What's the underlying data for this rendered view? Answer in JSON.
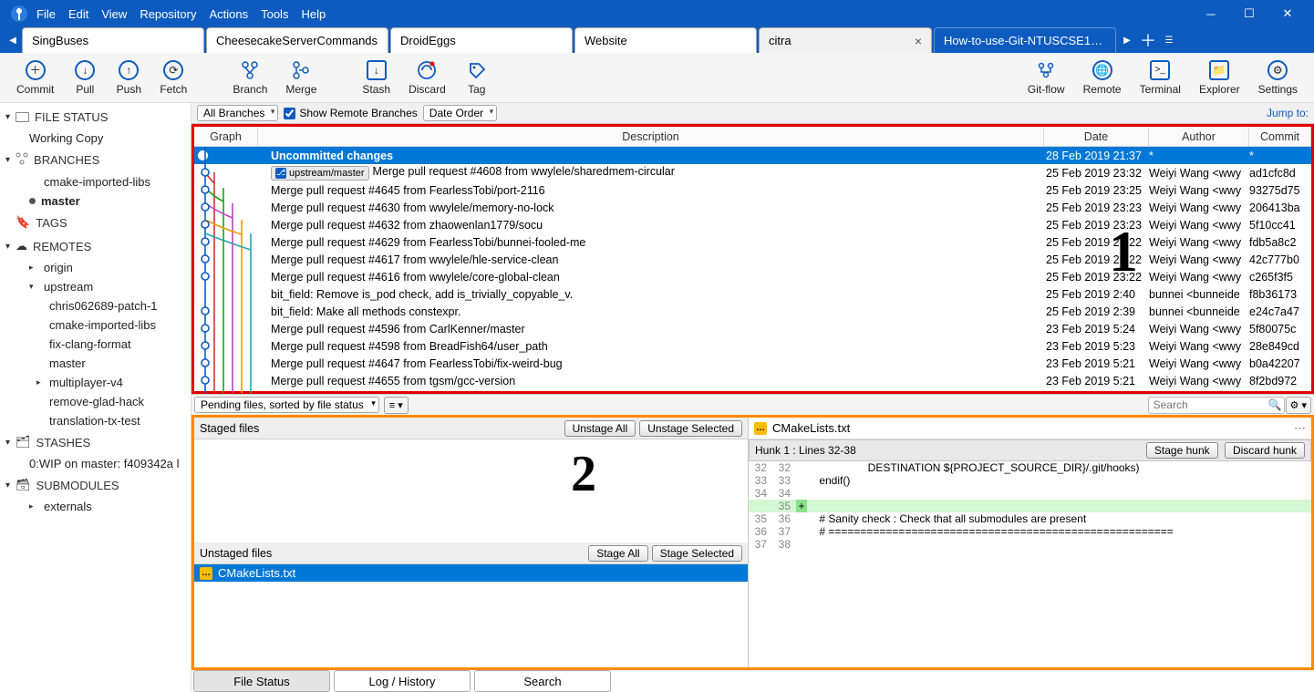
{
  "menu": {
    "file": "File",
    "edit": "Edit",
    "view": "View",
    "repository": "Repository",
    "actions": "Actions",
    "tools": "Tools",
    "help": "Help"
  },
  "tabs": [
    {
      "label": "SingBuses"
    },
    {
      "label": "CheesecakeServerCommands"
    },
    {
      "label": "DroidEggs"
    },
    {
      "label": "Website"
    },
    {
      "label": "citra",
      "active": true
    },
    {
      "label": "How-to-use-Git-NTUSCSE1…"
    }
  ],
  "toolbar": {
    "commit": "Commit",
    "pull": "Pull",
    "push": "Push",
    "fetch": "Fetch",
    "branch": "Branch",
    "merge": "Merge",
    "stash": "Stash",
    "discard": "Discard",
    "tag": "Tag",
    "gitflow": "Git-flow",
    "remote": "Remote",
    "terminal": "Terminal",
    "explorer": "Explorer",
    "settings": "Settings"
  },
  "filter": {
    "all_branches": "All Branches",
    "show_remote": "Show Remote Branches",
    "date_order": "Date Order",
    "jump": "Jump to:"
  },
  "columns": {
    "graph": "Graph",
    "description": "Description",
    "date": "Date",
    "author": "Author",
    "commit": "Commit"
  },
  "sidebar": {
    "file_status_hd": "FILE STATUS",
    "working_copy": "Working Copy",
    "branches_hd": "BRANCHES",
    "branches": [
      {
        "l": "cmake-imported-libs"
      },
      {
        "l": "master",
        "sel": true
      }
    ],
    "tags_hd": "TAGS",
    "remotes_hd": "REMOTES",
    "remotes": [
      {
        "l": "origin",
        "children": []
      },
      {
        "l": "upstream",
        "expanded": true,
        "children": [
          "chris062689-patch-1",
          "cmake-imported-libs",
          "fix-clang-format",
          "master",
          "multiplayer-v4",
          "remove-glad-hack",
          "translation-tx-test"
        ]
      }
    ],
    "stashes_hd": "STASHES",
    "stash0": "0:WIP on master: f409342a l",
    "submodules_hd": "SUBMODULES",
    "sub0": "externals"
  },
  "commits": [
    {
      "desc": "Uncommitted changes",
      "date": "28 Feb 2019 21:37",
      "auth": "*",
      "hash": "*",
      "sel": true,
      "bold": true
    },
    {
      "badge": "upstream/master",
      "desc": "Merge pull request #4608 from wwylele/sharedmem-circular",
      "date": "25 Feb 2019 23:32",
      "auth": "Weiyi Wang <wwy",
      "hash": "ad1cfc8d"
    },
    {
      "desc": "Merge pull request #4645 from FearlessTobi/port-2116",
      "date": "25 Feb 2019 23:25",
      "auth": "Weiyi Wang <wwy",
      "hash": "93275d75"
    },
    {
      "desc": "Merge pull request #4630 from wwylele/memory-no-lock",
      "date": "25 Feb 2019 23:23",
      "auth": "Weiyi Wang <wwy",
      "hash": "206413ba"
    },
    {
      "desc": "Merge pull request #4632 from zhaowenlan1779/socu",
      "date": "25 Feb 2019 23:23",
      "auth": "Weiyi Wang <wwy",
      "hash": "5f10cc41"
    },
    {
      "desc": "Merge pull request #4629 from FearlessTobi/bunnei-fooled-me",
      "date": "25 Feb 2019 23:22",
      "auth": "Weiyi Wang <wwy",
      "hash": "fdb5a8c2"
    },
    {
      "desc": "Merge pull request #4617 from wwylele/hle-service-clean",
      "date": "25 Feb 2019 23:22",
      "auth": "Weiyi Wang <wwy",
      "hash": "42c777b0"
    },
    {
      "desc": "Merge pull request #4616 from wwylele/core-global-clean",
      "date": "25 Feb 2019 23:22",
      "auth": "Weiyi Wang <wwy",
      "hash": "c265f3f5"
    },
    {
      "desc": "bit_field: Remove is_pod check, add is_trivially_copyable_v.",
      "date": "25 Feb 2019 2:40",
      "auth": "bunnei <bunneide",
      "hash": "f8b36173"
    },
    {
      "desc": "bit_field: Make all methods constexpr.",
      "date": "25 Feb 2019 2:39",
      "auth": "bunnei <bunneide",
      "hash": "e24c7a47"
    },
    {
      "desc": "Merge pull request #4596 from CarlKenner/master",
      "date": "23 Feb 2019 5:24",
      "auth": "Weiyi Wang <wwy",
      "hash": "5f80075c"
    },
    {
      "desc": "Merge pull request #4598 from BreadFish64/user_path",
      "date": "23 Feb 2019 5:23",
      "auth": "Weiyi Wang <wwy",
      "hash": "28e849cd"
    },
    {
      "desc": "Merge pull request #4647 from FearlessTobi/fix-weird-bug",
      "date": "23 Feb 2019 5:21",
      "auth": "Weiyi Wang <wwy",
      "hash": "b0a42207"
    },
    {
      "desc": "Merge pull request #4655 from tgsm/gcc-version",
      "date": "23 Feb 2019 5:21",
      "auth": "Weiyi Wang <wwy",
      "hash": "8f2bd972"
    }
  ],
  "sort": {
    "pending": "Pending files, sorted by file status",
    "search_ph": "Search"
  },
  "bottom": {
    "staged_hd": "Staged files",
    "unstage_all": "Unstage All",
    "unstage_sel": "Unstage Selected",
    "unstaged_hd": "Unstaged files",
    "stage_all": "Stage All",
    "stage_sel": "Stage Selected",
    "file": "CMakeLists.txt",
    "diff_file": "CMakeLists.txt",
    "hunk": "Hunk 1 : Lines 32-38",
    "stage_hunk": "Stage hunk",
    "discard_hunk": "Discard hunk",
    "lines": [
      {
        "a": "32",
        "b": "32",
        "t": "                    DESTINATION ${PROJECT_SOURCE_DIR}/.git/hooks)"
      },
      {
        "a": "33",
        "b": "33",
        "t": "    endif()"
      },
      {
        "a": "34",
        "b": "34",
        "t": ""
      },
      {
        "a": "",
        "b": "35",
        "t": "",
        "add": true
      },
      {
        "a": "35",
        "b": "36",
        "t": "    # Sanity check : Check that all submodules are present"
      },
      {
        "a": "36",
        "b": "37",
        "t": "    # ======================================================"
      },
      {
        "a": "37",
        "b": "38",
        "t": ""
      }
    ]
  },
  "btabs": {
    "filestatus": "File Status",
    "loghistory": "Log / History",
    "search": "Search"
  }
}
